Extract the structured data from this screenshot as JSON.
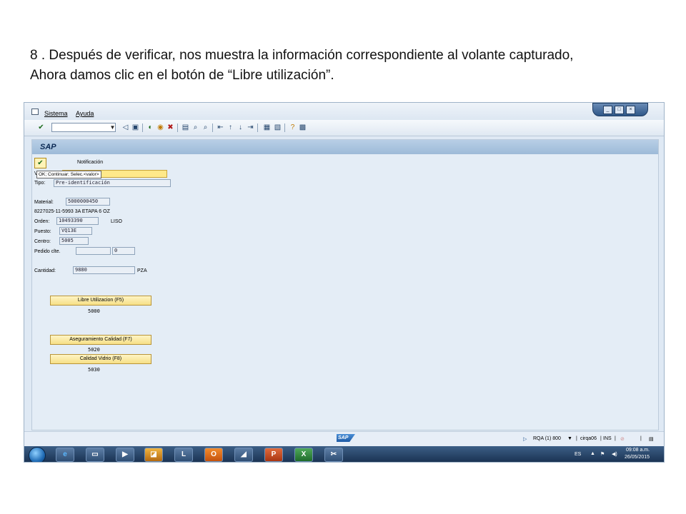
{
  "caption": {
    "line1": "8 . Después de verificar, nos muestra la información correspondiente al volante capturado,",
    "line2": "Ahora damos clic en el botón de “Libre utilización”."
  },
  "menu": {
    "sistema": "Sistema",
    "ayuda": "Ayuda"
  },
  "window_controls": {
    "min": "_",
    "max": "□",
    "close": "×"
  },
  "screen_title": "SAP",
  "form": {
    "notificacion_label": "Notificación",
    "tooltip": "OK; Continuar; Selec.<valor>",
    "row2_label": "V",
    "tipo_label": "Tipo:",
    "tipo_value": "Pre-identificación",
    "material_label": "Material:",
    "material_value": "5000000450",
    "material_desc": "8227025-11-5993 3A ETAPA 6 OZ",
    "orden_label": "Orden:",
    "orden_value": "10493390",
    "orden_desc": "LISO",
    "puesto_label": "Puesto:",
    "puesto_value": "VQ13E",
    "centro_label": "Centro:",
    "centro_value": "5005",
    "pedido_label": "Pedido clte.",
    "pedido_value1": "",
    "pedido_value2": "0",
    "cantidad_label": "Cantidad:",
    "cantidad_value": "9880",
    "cantidad_unit": "PZA"
  },
  "buttons": {
    "libre": {
      "label": "Libre Utilizacion (F5)",
      "code": "5000"
    },
    "aseguramiento": {
      "label": "Aseguramiento Calidad (F7)",
      "code": "5020"
    },
    "vidrio": {
      "label": "Calidad Vidrio (F8)",
      "code": "5030"
    }
  },
  "status": {
    "system": "RQA (1) 800",
    "server": "cirqa06",
    "mode": "INS"
  },
  "tray": {
    "lang": "ES",
    "time": "09:08 a.m.",
    "date": "26/05/2015"
  },
  "colors": {
    "accent": "#1d5aa6",
    "button_yellow": "#f6df86",
    "background": "#e4edf6"
  }
}
